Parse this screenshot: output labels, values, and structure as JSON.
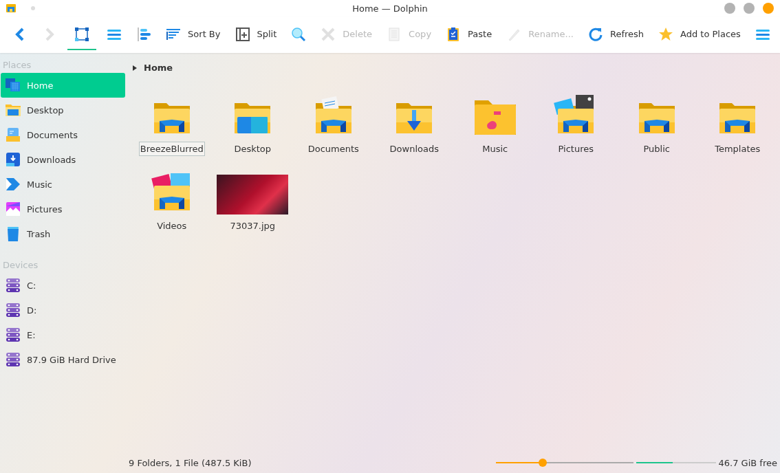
{
  "window": {
    "title": "Home — Dolphin"
  },
  "toolbar": [
    {
      "kind": "nav",
      "disabled": false
    },
    {
      "kind": "nav",
      "disabled": true
    },
    {
      "kind": "view",
      "selected": true
    },
    {
      "kind": "view",
      "selected": false
    },
    {
      "kind": "view",
      "selected": false
    },
    {
      "kind": "action",
      "label": "Sort By",
      "disabled": false
    },
    {
      "kind": "action",
      "label": "Split",
      "disabled": false
    },
    {
      "kind": "tool",
      "disabled": false
    },
    {
      "kind": "action",
      "label": "Delete",
      "disabled": true
    },
    {
      "kind": "action",
      "label": "Copy",
      "disabled": true
    },
    {
      "kind": "action",
      "label": "Paste",
      "disabled": false
    },
    {
      "kind": "action",
      "label": "Rename...",
      "disabled": true
    },
    {
      "kind": "action",
      "label": "Refresh",
      "disabled": false
    },
    {
      "kind": "action",
      "label": "Add to Places",
      "disabled": false
    },
    {
      "kind": "tool",
      "disabled": false
    }
  ],
  "sidebar": [
    {
      "title": "Places",
      "items": [
        {
          "label": "Home",
          "selected": true
        },
        {
          "label": "Desktop",
          "selected": false
        },
        {
          "label": "Documents",
          "selected": false
        },
        {
          "label": "Downloads",
          "selected": false
        },
        {
          "label": "Music",
          "selected": false
        },
        {
          "label": "Pictures",
          "selected": false
        },
        {
          "label": "Trash",
          "selected": false
        }
      ]
    },
    {
      "title": "Devices",
      "items": [
        {
          "label": "C:",
          "selected": false
        },
        {
          "label": "D:",
          "selected": false
        },
        {
          "label": "E:",
          "selected": false
        },
        {
          "label": "87.9 GiB Hard Drive",
          "selected": false
        }
      ]
    }
  ],
  "breadcrumb": "Home",
  "files": [
    {
      "name": "BreezeBlurred",
      "kind": "folder",
      "focused": true
    },
    {
      "name": "Desktop",
      "kind": "folder",
      "focused": false
    },
    {
      "name": "Documents",
      "kind": "folder",
      "focused": false
    },
    {
      "name": "Downloads",
      "kind": "folder",
      "focused": false
    },
    {
      "name": "Music",
      "kind": "folder",
      "focused": false
    },
    {
      "name": "Pictures",
      "kind": "folder",
      "focused": false
    },
    {
      "name": "Public",
      "kind": "folder",
      "focused": false
    },
    {
      "name": "Templates",
      "kind": "folder",
      "focused": false
    },
    {
      "name": "Videos",
      "kind": "folder",
      "focused": false
    },
    {
      "name": "73037.jpg",
      "kind": "image",
      "focused": false
    }
  ],
  "status_bar": {
    "text": "9 Folders, 1 File (487.5 KiB)",
    "zoom": {
      "level": 0.34
    },
    "space": {
      "level": 0.46
    },
    "free": "46.7 GiB free"
  }
}
